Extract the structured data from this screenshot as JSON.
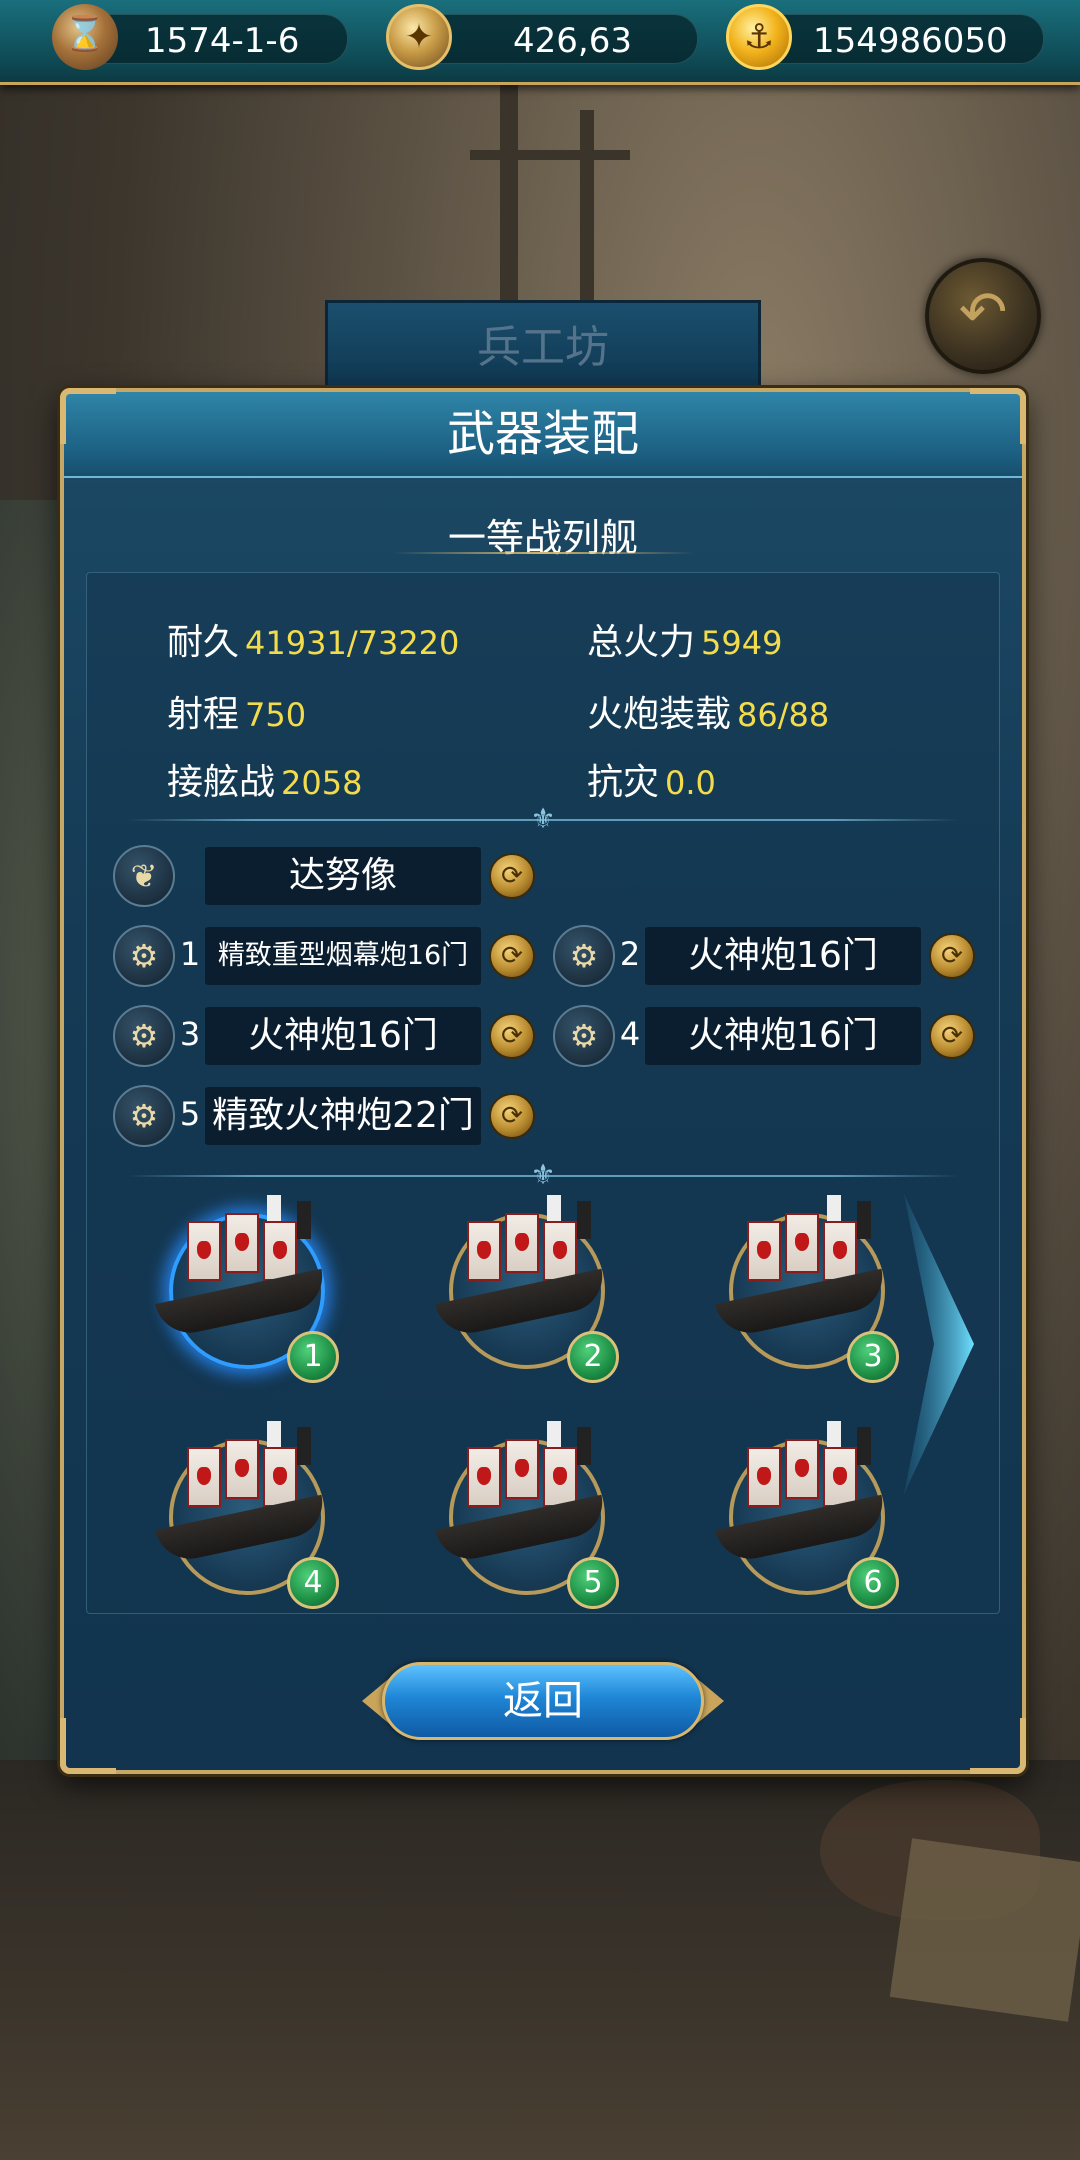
{
  "topbar": {
    "date": "1574-1-6",
    "coords": "426,63",
    "gold": "154986050"
  },
  "background": {
    "workshop_sign": "兵工坊"
  },
  "panel": {
    "title": "武器装配",
    "ship_class": "一等战列舰",
    "stats": {
      "durability": {
        "label": "耐久",
        "value": "41931/73220"
      },
      "firepower": {
        "label": "总火力",
        "value": "5949"
      },
      "range": {
        "label": "射程",
        "value": "750"
      },
      "cannon_load": {
        "label": "火炮装载",
        "value": "86/88"
      },
      "boarding": {
        "label": "接舷战",
        "value": "2058"
      },
      "disaster_resist": {
        "label": "抗灾",
        "value": "0.0"
      }
    },
    "figurehead": "达努像",
    "slots": [
      {
        "num": "1",
        "name": "精致重型烟幕炮16门"
      },
      {
        "num": "2",
        "name": "火神炮16门"
      },
      {
        "num": "3",
        "name": "火神炮16门"
      },
      {
        "num": "4",
        "name": "火神炮16门"
      },
      {
        "num": "5",
        "name": "精致火神炮22门"
      }
    ],
    "ships": [
      {
        "badge": "1",
        "selected": true
      },
      {
        "badge": "2",
        "selected": false
      },
      {
        "badge": "3",
        "selected": false
      },
      {
        "badge": "4",
        "selected": false
      },
      {
        "badge": "5",
        "selected": false
      },
      {
        "badge": "6",
        "selected": false
      }
    ],
    "return_label": "返回"
  },
  "icons": {
    "date": "hourglass-icon",
    "coords": "compass-icon",
    "gold": "gold-anchor-coin-icon",
    "figurehead": "wing-icon",
    "cannon": "cannon-icon",
    "swap": "swap-icon",
    "back": "back-arrow-icon"
  },
  "colors": {
    "stat_value": "#f3dc4c",
    "panel_border": "#c7a766",
    "selection_glow": "#2f9cff"
  }
}
